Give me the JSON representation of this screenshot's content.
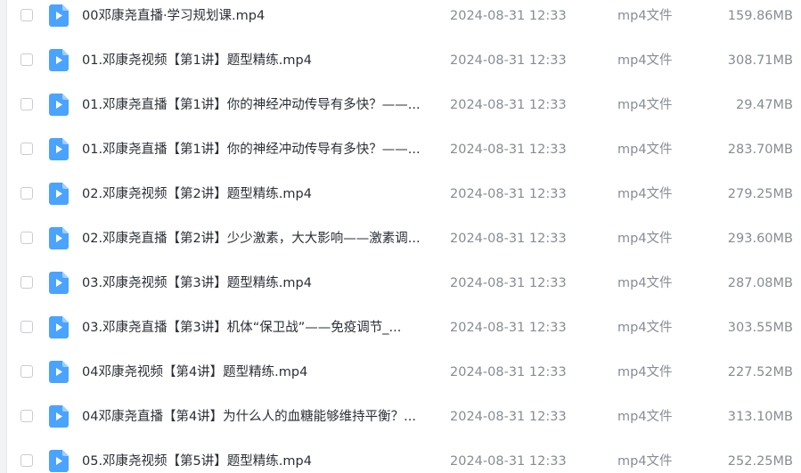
{
  "icon": "video-file-icon",
  "colors": {
    "icon_fill": "#4aa3ff",
    "icon_fold": "#9fd0ff",
    "name_text": "#2b2f36",
    "meta_text": "#878c94",
    "checkbox_border": "#c8ccd3"
  },
  "files": [
    {
      "name": "00邓康尧直播·学习规划课.mp4",
      "date": "2024-08-31 12:33",
      "type": "mp4文件",
      "size": "159.86MB"
    },
    {
      "name": "01.邓康尧视频【第1讲】题型精练.mp4",
      "date": "2024-08-31 12:33",
      "type": "mp4文件",
      "size": "308.71MB"
    },
    {
      "name": "01.邓康尧直播【第1讲】你的神经冲动传导有多快？——...",
      "date": "2024-08-31 12:33",
      "type": "mp4文件",
      "size": "29.47MB"
    },
    {
      "name": "01.邓康尧直播【第1讲】你的神经冲动传导有多快？——...",
      "date": "2024-08-31 12:33",
      "type": "mp4文件",
      "size": "283.70MB"
    },
    {
      "name": "02.邓康尧视频【第2讲】题型精练.mp4",
      "date": "2024-08-31 12:33",
      "type": "mp4文件",
      "size": "279.25MB"
    },
    {
      "name": "02.邓康尧直播【第2讲】少少激素，大大影响——激素调...",
      "date": "2024-08-31 12:33",
      "type": "mp4文件",
      "size": "293.60MB"
    },
    {
      "name": "03.邓康尧视频【第3讲】题型精练.mp4",
      "date": "2024-08-31 12:33",
      "type": "mp4文件",
      "size": "287.08MB"
    },
    {
      "name": "03.邓康尧直播【第3讲】机体“保卫战”——免疫调节_...",
      "date": "2024-08-31 12:33",
      "type": "mp4文件",
      "size": "303.55MB"
    },
    {
      "name": "04邓康尧视频【第4讲】题型精练.mp4",
      "date": "2024-08-31 12:33",
      "type": "mp4文件",
      "size": "227.52MB"
    },
    {
      "name": "04邓康尧直播【第4讲】为什么人的血糖能够维持平衡？...",
      "date": "2024-08-31 12:33",
      "type": "mp4文件",
      "size": "313.10MB"
    },
    {
      "name": "05.邓康尧视频【第5讲】题型精练.mp4",
      "date": "2024-08-31 12:33",
      "type": "mp4文件",
      "size": "252.25MB"
    }
  ]
}
